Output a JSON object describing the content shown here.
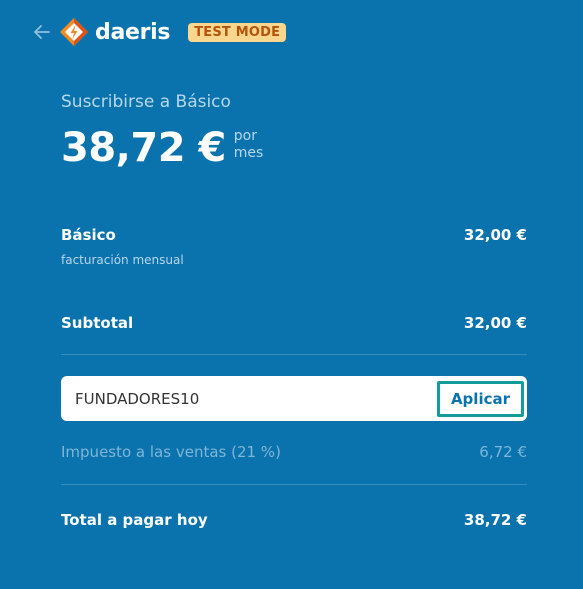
{
  "header": {
    "brand": "daeris",
    "badge": "TEST MODE"
  },
  "plan": {
    "title": "Suscribirse a Básico",
    "price": "38,72 €",
    "period_line1": "por",
    "period_line2": "mes"
  },
  "line_items": [
    {
      "name": "Básico",
      "sub": "facturación mensual",
      "amount": "32,00 €"
    }
  ],
  "subtotal": {
    "label": "Subtotal",
    "amount": "32,00 €"
  },
  "promo": {
    "code": "FUNDADORES10",
    "apply_label": "Aplicar"
  },
  "tax": {
    "label": "Impuesto a las ventas (21 %)",
    "amount": "6,72 €"
  },
  "total": {
    "label": "Total a pagar hoy",
    "amount": "38,72 €"
  },
  "colors": {
    "background": "#0a73ad",
    "badge_bg": "#fbd68f",
    "badge_text": "#b4540a",
    "focus_ring": "#139c99"
  }
}
